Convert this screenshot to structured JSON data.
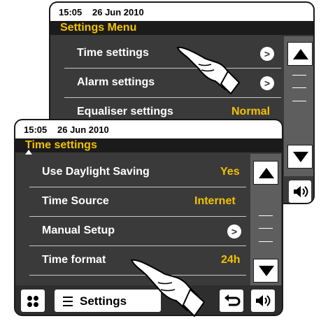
{
  "back_screen": {
    "status": {
      "time": "15:05",
      "date": "26 Jun 2010"
    },
    "title": "Settings Menu",
    "items": [
      {
        "label": "Time settings",
        "has_chevron": true
      },
      {
        "label": "Alarm settings",
        "has_chevron": true
      },
      {
        "label": "Equaliser settings",
        "value": "Normal"
      }
    ],
    "chevron_glyph": ">"
  },
  "front_screen": {
    "status": {
      "time": "15:05",
      "date": "26 Jun 2010"
    },
    "title": "Time settings",
    "items": [
      {
        "label": "Use Daylight Saving",
        "value": "Yes"
      },
      {
        "label": "Time Source",
        "value": "Internet"
      },
      {
        "label": "Manual Setup",
        "has_chevron": true
      },
      {
        "label": "Time format",
        "value": "24h"
      }
    ],
    "chevron_glyph": ">",
    "bottom_bar": {
      "settings_label": "Settings"
    }
  },
  "icons": {
    "up": "up-arrow-icon",
    "down": "down-arrow-icon",
    "volume": "volume-icon",
    "home": "grid-icon",
    "back": "back-icon",
    "menu": "menu-icon",
    "pointer": "pointing-hand-icon"
  },
  "colors": {
    "accent": "#f4c200",
    "panel": "#3a3a3a",
    "scroll": "#5e5e5e"
  }
}
